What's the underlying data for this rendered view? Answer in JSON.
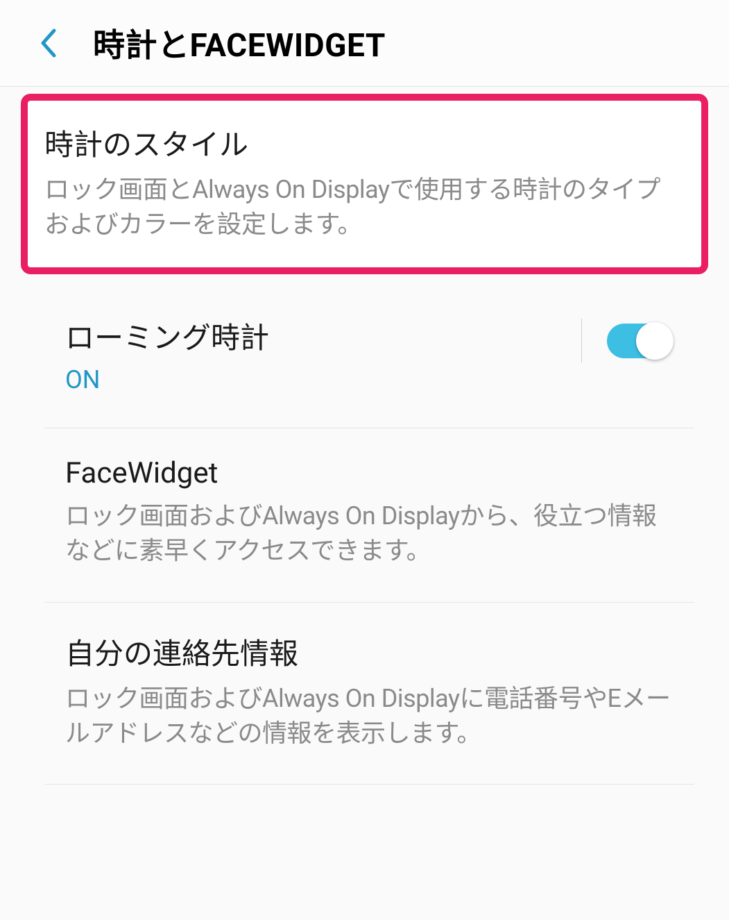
{
  "header": {
    "title": "時計とFACEWIDGET"
  },
  "settings": {
    "clockStyle": {
      "title": "時計のスタイル",
      "description": "ロック画面とAlways On Displayで使用する時計のタイプおよびカラーを設定します。"
    },
    "roamingClock": {
      "title": "ローミング時計",
      "status": "ON"
    },
    "faceWidget": {
      "title": "FaceWidget",
      "description": "ロック画面およびAlways On Displayから、役立つ情報などに素早くアクセスできます。"
    },
    "contactInfo": {
      "title": "自分の連絡先情報",
      "description": "ロック画面およびAlways On Displayに電話番号やEメールアドレスなどの情報を表示します。"
    }
  }
}
